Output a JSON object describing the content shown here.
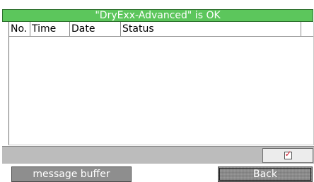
{
  "status_bar": {
    "text": "\"DryExx-Advanced\" is OK",
    "color": "#5cc65c"
  },
  "table": {
    "columns": [
      "No.",
      "Time",
      "Date",
      "Status"
    ],
    "rows": []
  },
  "footer": {
    "acknowledge_checkbox": {
      "checked": true,
      "mark_color": "#d3162a",
      "icon": "checkbox-checked-icon"
    }
  },
  "buttons": {
    "message_buffer": "message buffer",
    "back": "Back"
  }
}
